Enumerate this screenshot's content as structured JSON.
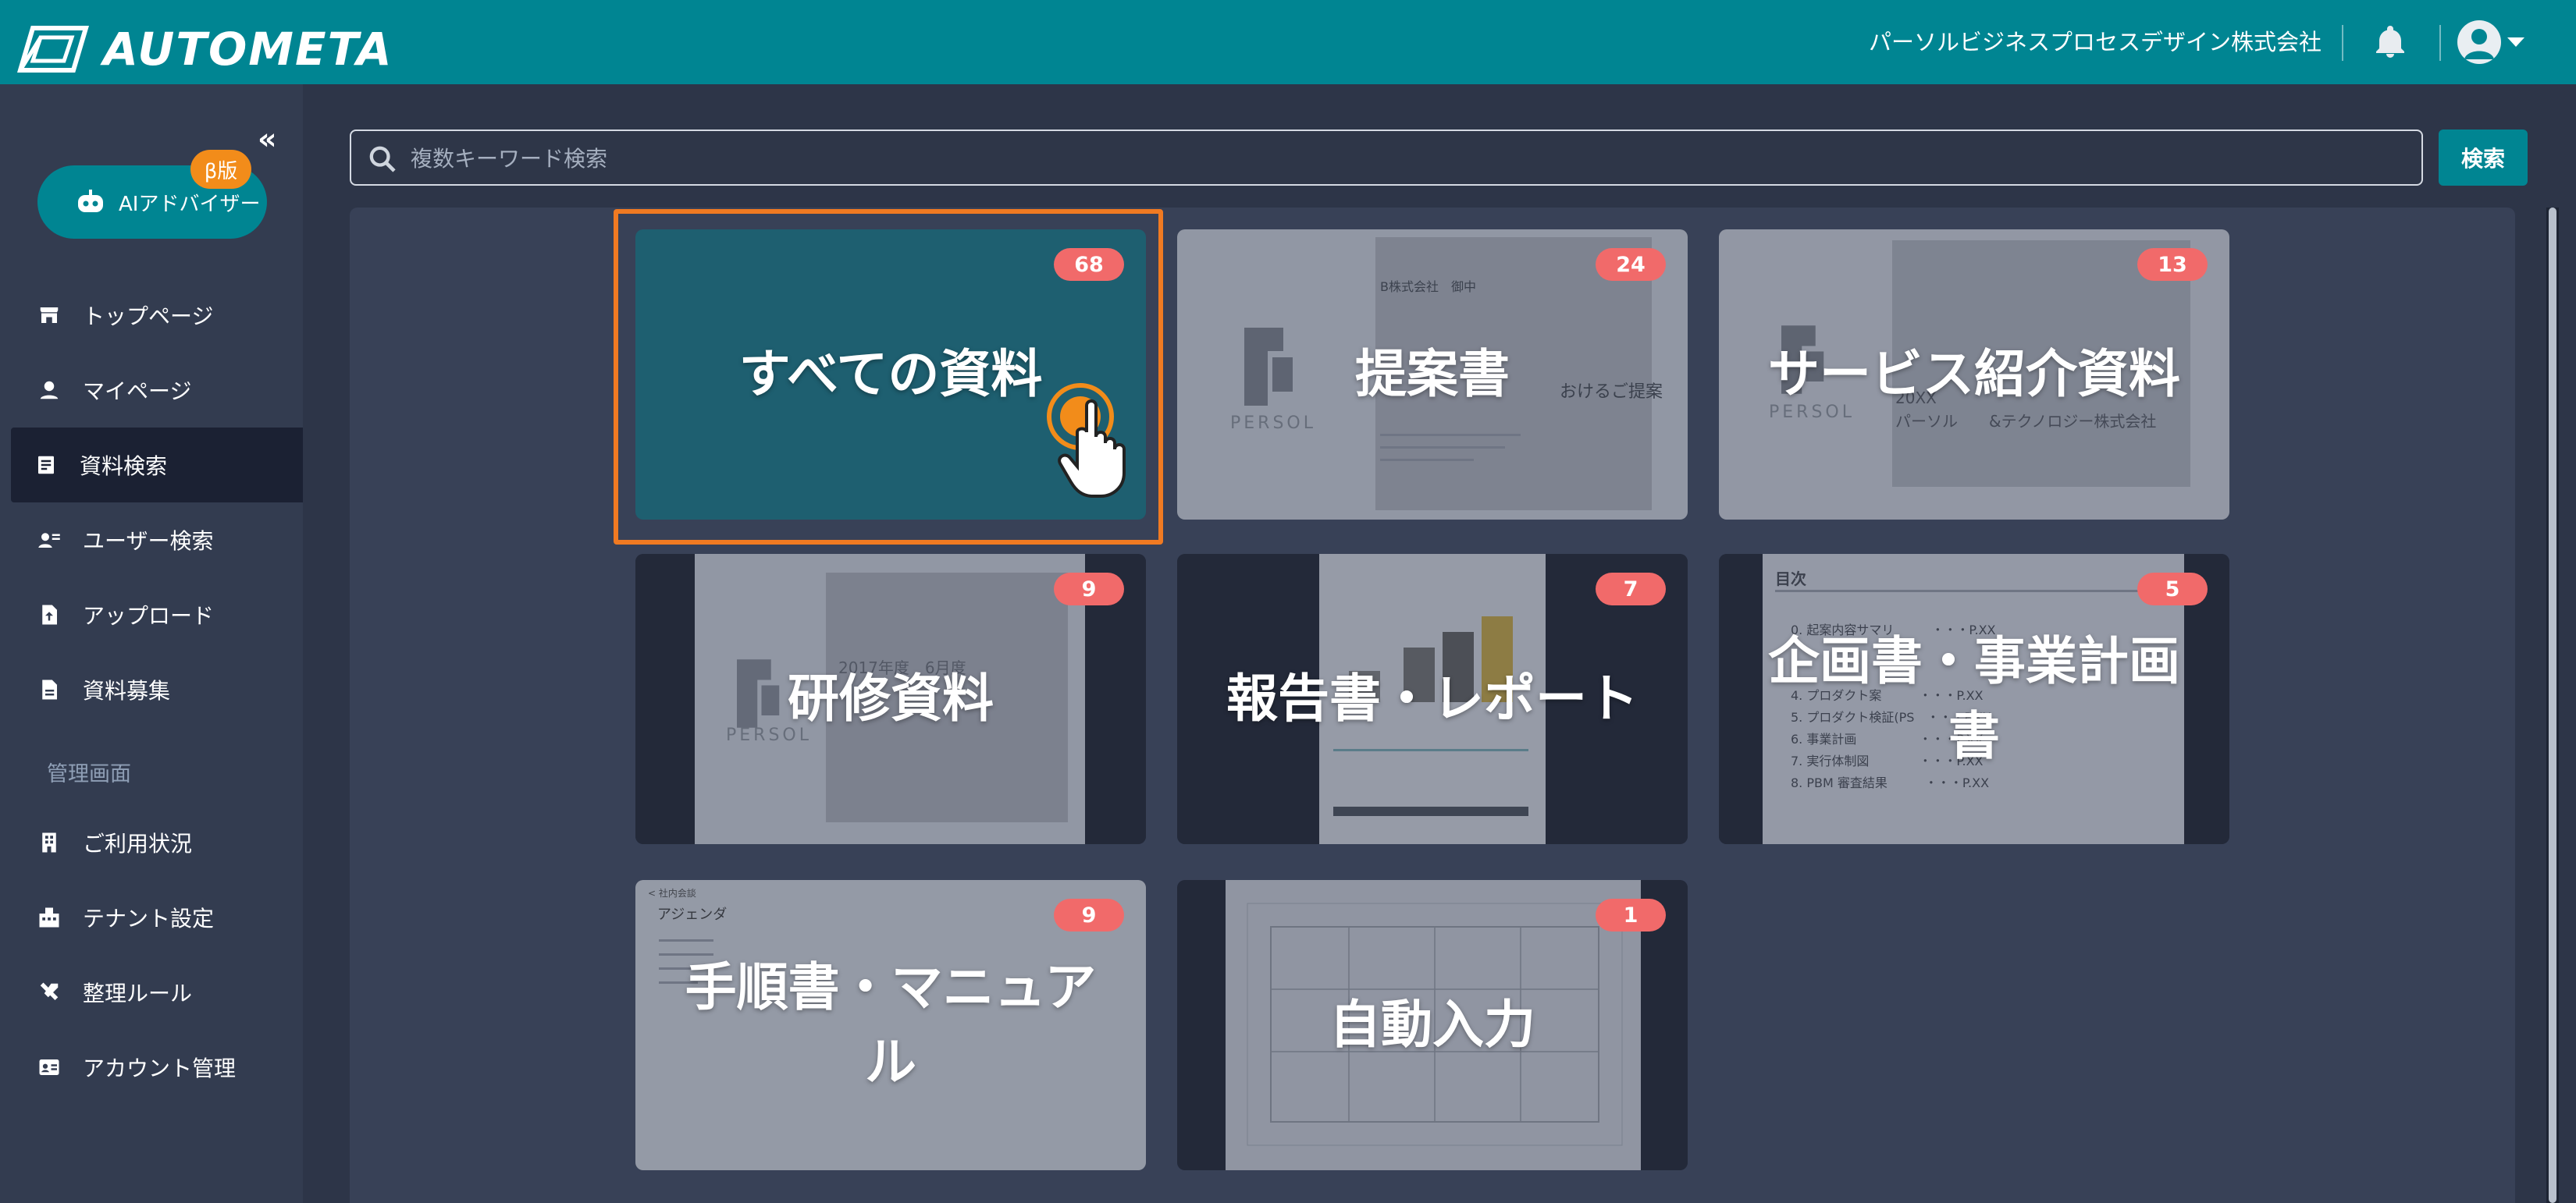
{
  "header": {
    "app_name": "AUTOMETA",
    "company": "パーソルビジネスプロセスデザイン株式会社"
  },
  "sidebar": {
    "ai_button": "AIアドバイザー",
    "beta_badge": "β版",
    "items": [
      {
        "label": "トップページ",
        "icon": "store-icon"
      },
      {
        "label": "マイページ",
        "icon": "person-icon"
      },
      {
        "label": "資料検索",
        "icon": "document-list-icon",
        "active": true
      },
      {
        "label": "ユーザー検索",
        "icon": "user-search-icon"
      },
      {
        "label": "アップロード",
        "icon": "file-upload-icon"
      },
      {
        "label": "資料募集",
        "icon": "file-icon"
      }
    ],
    "admin_section": "管理画面",
    "admin_items": [
      {
        "label": "ご利用状況",
        "icon": "building-icon"
      },
      {
        "label": "テナント設定",
        "icon": "tenant-icon"
      },
      {
        "label": "整理ルール",
        "icon": "tools-icon"
      },
      {
        "label": "アカウント管理",
        "icon": "id-card-icon"
      }
    ]
  },
  "search": {
    "placeholder": "複数キーワード検索",
    "button": "検索"
  },
  "categories": [
    {
      "label": "すべての資料",
      "count": "68"
    },
    {
      "label": "提案書",
      "count": "24"
    },
    {
      "label": "サービス紹介資料",
      "count": "13"
    },
    {
      "label": "研修資料",
      "count": "9"
    },
    {
      "label": "報告書・レポート",
      "count": "7"
    },
    {
      "label": "企画書・事業計画書",
      "count": "5"
    },
    {
      "label": "手順書・マニュアル",
      "count": "9"
    },
    {
      "label": "自動入力",
      "count": "1"
    }
  ],
  "thumbs": {
    "proposal_client": "B株式会社　御中",
    "proposal_title": "おけるご提案",
    "persol": "PERSOL",
    "service_year": "20XX",
    "service_company": "パーソル　　&テクノロジー株式会社",
    "training_year": "2017年度　6月度",
    "toc_title": "目次",
    "toc_items": [
      "0.  起案内容サマリ　　　・・・P.XX",
      "4. プロダクト案　　　・・・P.XX",
      "5. プロダクト検証(PS　・・・P.XX",
      "6. 事業計画　　　　　・・・P.XX",
      "7. 実行体制図　　　　・・・P.XX",
      "8. PBM 審査結果　　　・・・P.XX"
    ],
    "agenda_title": "アジェンダ",
    "agenda_back": "< 社内会談"
  },
  "colors": {
    "header": "#008592",
    "sidebar": "#333c50",
    "badge": "#f16a6a",
    "highlight": "#f07a22"
  }
}
